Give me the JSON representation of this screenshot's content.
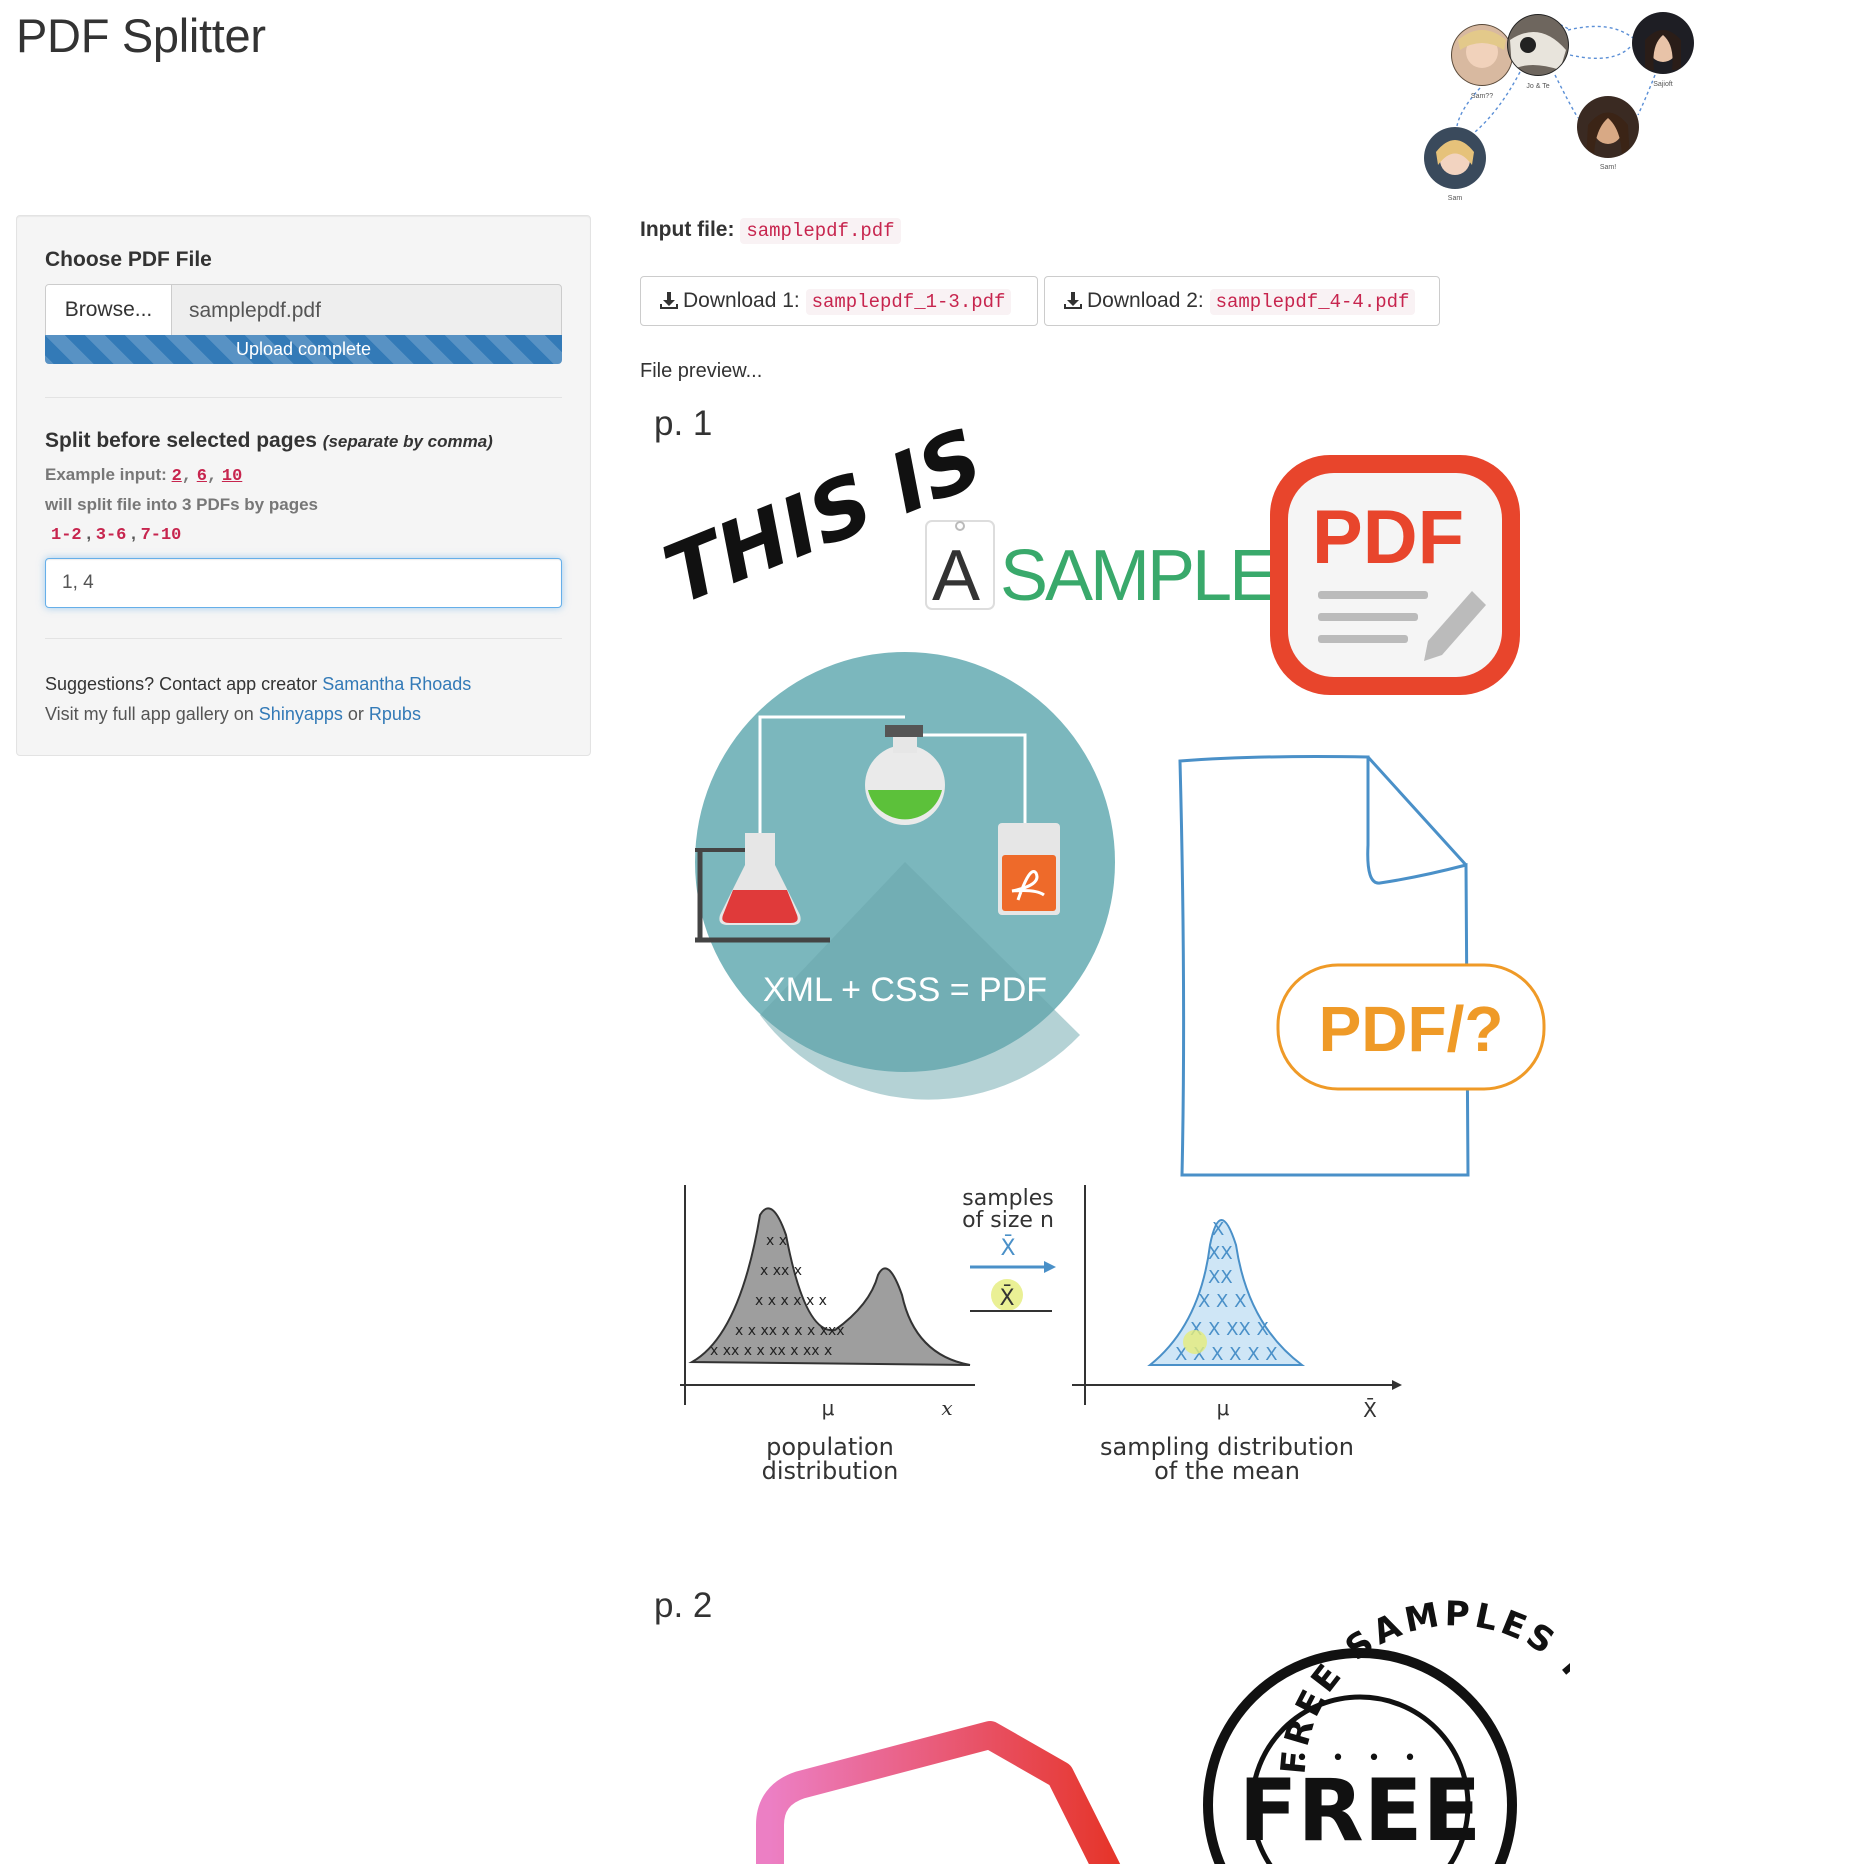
{
  "header": {
    "title": "PDF Splitter"
  },
  "avatars": {
    "labels": [
      "Sam??",
      "Jo & Te",
      "Sajioft",
      "Sam!",
      "Sam"
    ]
  },
  "sidebar": {
    "choose_label": "Choose PDF File",
    "browse_label": "Browse...",
    "file_name": "samplepdf.pdf",
    "upload_status": "Upload complete",
    "upload_progress": 1.0,
    "split_label": "Split before selected pages",
    "split_hint": "(separate by comma)",
    "example_prefix": "Example input:",
    "example_values": [
      "2",
      "6",
      "10"
    ],
    "will_split_text": "will split file into 3 PDFs by pages",
    "ranges": [
      "1-2",
      "3-6",
      "7-10"
    ],
    "split_input_value": "1, 4",
    "suggest_prefix": "Suggestions? Contact app creator",
    "creator_link": "Samantha Rhoads",
    "gallery_prefix": "Visit my full app gallery on",
    "gallery_link1": "Shinyapps",
    "gallery_or": "or",
    "gallery_link2": "Rpubs"
  },
  "main": {
    "input_file_label": "Input file:",
    "input_file_name": "samplepdf.pdf",
    "download1_label": "Download 1:",
    "download1_file": "samplepdf_1-3.pdf",
    "download2_label": "Download 2:",
    "download2_file": "samplepdf_4-4.pdf",
    "preview_label": "File preview..."
  },
  "preview": {
    "page1_label": "p. 1",
    "page2_label": "p. 2",
    "this_is": "THIS IS",
    "a_letter": "A",
    "sample_word": "SAMPLE!",
    "pdf_badge": "PDF",
    "xml_css": "XML + CSS = PDF",
    "pdf_question": "PDF/?",
    "samples_of": "samples",
    "size_n": "of size n",
    "xbar": "X̄",
    "mu": "μ",
    "x_axis_left": "x",
    "pop_dist_1": "population",
    "pop_dist_2": "distribution",
    "samp_dist_1": "sampling distribution",
    "samp_dist_2": "of the mean",
    "stamp_ring": "FREE SAMPLES FREE SAMPLES",
    "stamp_center": "FREE",
    "colors": {
      "pdf_red": "#e8452c",
      "teal": "#7bb7bd",
      "orange": "#ef9a27",
      "blue_line": "#4a90c8",
      "sample_green": "#39a96b"
    }
  }
}
